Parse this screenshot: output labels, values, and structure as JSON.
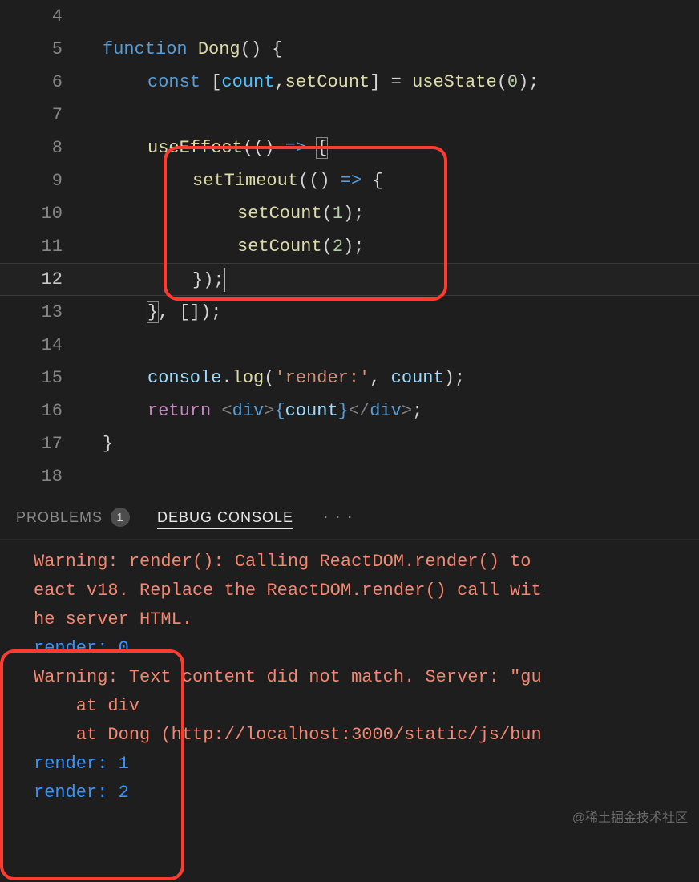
{
  "editor": {
    "lines": [
      {
        "num": 4,
        "tokens": []
      },
      {
        "num": 5,
        "tokens": [
          {
            "t": "function ",
            "c": "kw"
          },
          {
            "t": "Dong",
            "c": "fn"
          },
          {
            "t": "() {",
            "c": "punc"
          }
        ]
      },
      {
        "num": 6,
        "indent": 1,
        "tokens": [
          {
            "t": "const ",
            "c": "kw"
          },
          {
            "t": "[",
            "c": "punc"
          },
          {
            "t": "count",
            "c": "const"
          },
          {
            "t": ",",
            "c": "punc"
          },
          {
            "t": "setCount",
            "c": "fn"
          },
          {
            "t": "] = ",
            "c": "punc"
          },
          {
            "t": "useState",
            "c": "fn"
          },
          {
            "t": "(",
            "c": "punc"
          },
          {
            "t": "0",
            "c": "num"
          },
          {
            "t": ");",
            "c": "punc"
          }
        ]
      },
      {
        "num": 7,
        "indent": 1,
        "tokens": []
      },
      {
        "num": 8,
        "indent": 1,
        "tokens": [
          {
            "t": "useEffect",
            "c": "fn"
          },
          {
            "t": "(() ",
            "c": "punc"
          },
          {
            "t": "=>",
            "c": "kw"
          },
          {
            "t": " ",
            "c": "punc"
          },
          {
            "t": "{",
            "c": "punc bracket-hl"
          }
        ]
      },
      {
        "num": 9,
        "indent": 2,
        "tokens": [
          {
            "t": "setTimeout",
            "c": "fn"
          },
          {
            "t": "(() ",
            "c": "punc"
          },
          {
            "t": "=>",
            "c": "kw"
          },
          {
            "t": " {",
            "c": "punc"
          }
        ]
      },
      {
        "num": 10,
        "indent": 3,
        "tokens": [
          {
            "t": "setCount",
            "c": "fn"
          },
          {
            "t": "(",
            "c": "punc"
          },
          {
            "t": "1",
            "c": "num"
          },
          {
            "t": ");",
            "c": "punc"
          }
        ]
      },
      {
        "num": 11,
        "indent": 3,
        "tokens": [
          {
            "t": "setCount",
            "c": "fn"
          },
          {
            "t": "(",
            "c": "punc"
          },
          {
            "t": "2",
            "c": "num"
          },
          {
            "t": ");",
            "c": "punc"
          }
        ]
      },
      {
        "num": 12,
        "indent": 2,
        "active": true,
        "tokens": [
          {
            "t": "});",
            "c": "punc"
          },
          {
            "cursor": true
          }
        ]
      },
      {
        "num": 13,
        "indent": 1,
        "tokens": [
          {
            "t": "}",
            "c": "punc bracket-hl"
          },
          {
            "t": ", []);",
            "c": "punc"
          }
        ]
      },
      {
        "num": 14,
        "indent": 1,
        "tokens": []
      },
      {
        "num": 15,
        "indent": 1,
        "tokens": [
          {
            "t": "console",
            "c": "var"
          },
          {
            "t": ".",
            "c": "punc"
          },
          {
            "t": "log",
            "c": "fn"
          },
          {
            "t": "(",
            "c": "punc"
          },
          {
            "t": "'render:'",
            "c": "str"
          },
          {
            "t": ", ",
            "c": "punc"
          },
          {
            "t": "count",
            "c": "var"
          },
          {
            "t": ");",
            "c": "punc"
          }
        ]
      },
      {
        "num": 16,
        "indent": 1,
        "tokens": [
          {
            "t": "return ",
            "c": "kw2"
          },
          {
            "t": "<",
            "c": "tag"
          },
          {
            "t": "div",
            "c": "tagname"
          },
          {
            "t": ">",
            "c": "tag"
          },
          {
            "t": "{",
            "c": "kw"
          },
          {
            "t": "count",
            "c": "var"
          },
          {
            "t": "}",
            "c": "kw"
          },
          {
            "t": "</",
            "c": "tag"
          },
          {
            "t": "div",
            "c": "tagname"
          },
          {
            "t": ">",
            "c": "tag"
          },
          {
            "t": ";",
            "c": "punc"
          }
        ]
      },
      {
        "num": 17,
        "tokens": [
          {
            "t": "}",
            "c": "punc"
          }
        ]
      },
      {
        "num": 18,
        "tokens": []
      }
    ]
  },
  "panel": {
    "tabs": {
      "problems": {
        "label": "PROBLEMS",
        "badge": "1"
      },
      "debug": {
        "label": "DEBUG CONSOLE"
      },
      "more": "···"
    },
    "console": [
      {
        "cls": "warn",
        "text": "Warning: render(): Calling ReactDOM.render() to "
      },
      {
        "cls": "warn",
        "text": "eact v18. Replace the ReactDOM.render() call wit"
      },
      {
        "cls": "warn",
        "text": "he server HTML."
      },
      {
        "cls": "log-blue",
        "text": "render: 0"
      },
      {
        "cls": "warn",
        "text": "Warning: Text content did not match. Server: \"gu"
      },
      {
        "cls": "warn",
        "text": "    at div"
      },
      {
        "cls": "warn",
        "text": "    at Dong (http://localhost:3000/static/js/bun"
      },
      {
        "cls": "log-blue",
        "text": "render: 1"
      },
      {
        "cls": "log-blue",
        "text": "render: 2"
      }
    ]
  },
  "watermark": "@稀土掘金技术社区"
}
